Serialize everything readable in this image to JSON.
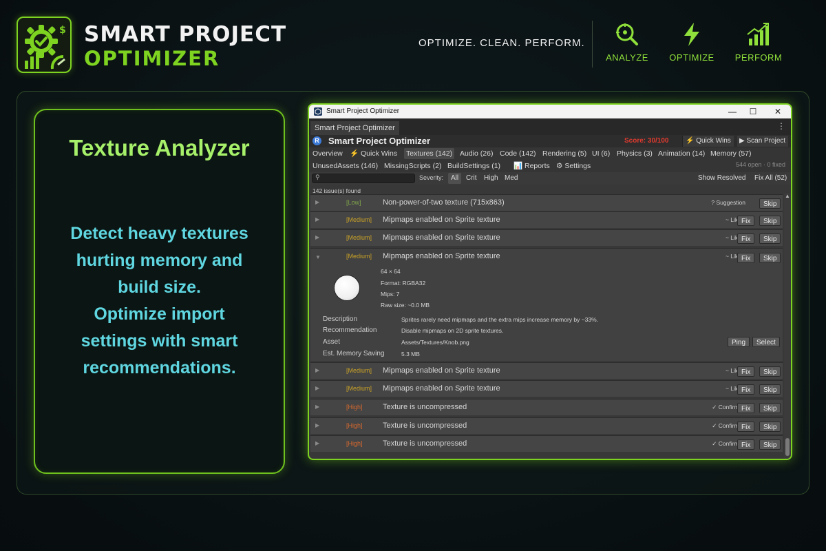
{
  "brand": {
    "line1": "SMART PROJECT",
    "line2": "OPTIMIZER"
  },
  "tagline": "OPTIMIZE. CLEAN. PERFORM.",
  "header_items": [
    {
      "label": "ANALYZE",
      "icon": "magnifier-target-icon"
    },
    {
      "label": "OPTIMIZE",
      "icon": "lightning-icon"
    },
    {
      "label": "PERFORM",
      "icon": "bar-chart-growth-icon"
    }
  ],
  "feature": {
    "title": "Texture Analyzer",
    "description": "Detect heavy textures\nhurting memory and\nbuild size.\n Optimize import\nsettings with smart\nrecommendations."
  },
  "window": {
    "title": "Smart Project Optimizer",
    "tab": "Smart Project Optimizer",
    "controls": [
      "—",
      "☐",
      "✕"
    ],
    "toolbar": {
      "app_name": "Smart Project Optimizer",
      "score": "Score: 30/100",
      "quick_wins": "⚡ Quick Wins",
      "scan": "▶ Scan Project"
    },
    "tabs_row1": [
      "Overview",
      "⚡ Quick Wins",
      "Textures (142)",
      "Audio (26)",
      "Code (142)",
      "Rendering (5)",
      "UI (6)",
      "Physics (3)",
      "Animation (14)",
      "Memory (57)"
    ],
    "tabs_row2": [
      "UnusedAssets (146)",
      "MissingScripts (2)",
      "BuildSettings (1)",
      "📊 Reports",
      "⚙ Settings"
    ],
    "open_fixed": "544 open · 0 fixed",
    "search_placeholder": "",
    "severity_label": "Severity:",
    "severity_filters": [
      "All",
      "Crit",
      "High",
      "Med"
    ],
    "show_resolved": "Show Resolved",
    "fix_all": "Fix All (52)",
    "issues_found": "142 issue(s) found",
    "fix_label": "Fix",
    "skip_label": "Skip",
    "issues": [
      {
        "severity": "[Low]",
        "level": "low",
        "title": "Non-power-of-two texture (715x863)",
        "status": "? Suggestion",
        "fix": false
      },
      {
        "severity": "[Medium]",
        "level": "medium",
        "title": "Mipmaps enabled on Sprite texture",
        "status": "~ Likely",
        "fix": true
      },
      {
        "severity": "[Medium]",
        "level": "medium",
        "title": "Mipmaps enabled on Sprite texture",
        "status": "~ Likely",
        "fix": true
      }
    ],
    "expanded_issue": {
      "severity": "[Medium]",
      "title": "Mipmaps enabled on Sprite texture",
      "status": "~ Likely",
      "size": "64 × 64",
      "format": "Format: RGBA32",
      "mips": "Mips: 7",
      "raw_size": "Raw size: ~0.0 MB",
      "details": [
        {
          "label": "Description",
          "value": "Sprites rarely need mipmaps and the extra mips increase memory by ~33%."
        },
        {
          "label": "Recommendation",
          "value": "Disable mipmaps on 2D sprite textures."
        },
        {
          "label": "Asset",
          "value": "Assets/Textures/Knob.png"
        },
        {
          "label": "Est. Memory Saving",
          "value": "5.3 MB"
        }
      ],
      "ping": "Ping",
      "select": "Select"
    },
    "issues_after": [
      {
        "severity": "[Medium]",
        "level": "medium",
        "title": "Mipmaps enabled on Sprite texture",
        "status": "~ Likely"
      },
      {
        "severity": "[Medium]",
        "level": "medium",
        "title": "Mipmaps enabled on Sprite texture",
        "status": "~ Likely"
      },
      {
        "severity": "[High]",
        "level": "high",
        "title": "Texture is uncompressed",
        "status": "✓ Confirmed"
      },
      {
        "severity": "[High]",
        "level": "high",
        "title": "Texture is uncompressed",
        "status": "✓ Confirmed"
      },
      {
        "severity": "[High]",
        "level": "high",
        "title": "Texture is uncompressed",
        "status": "✓ Confirmed"
      }
    ]
  },
  "colors": {
    "accent_green": "#7ed321",
    "title_green": "#a6f06a",
    "desc_cyan": "#5fd6e0",
    "score_red": "#e03a2e"
  }
}
